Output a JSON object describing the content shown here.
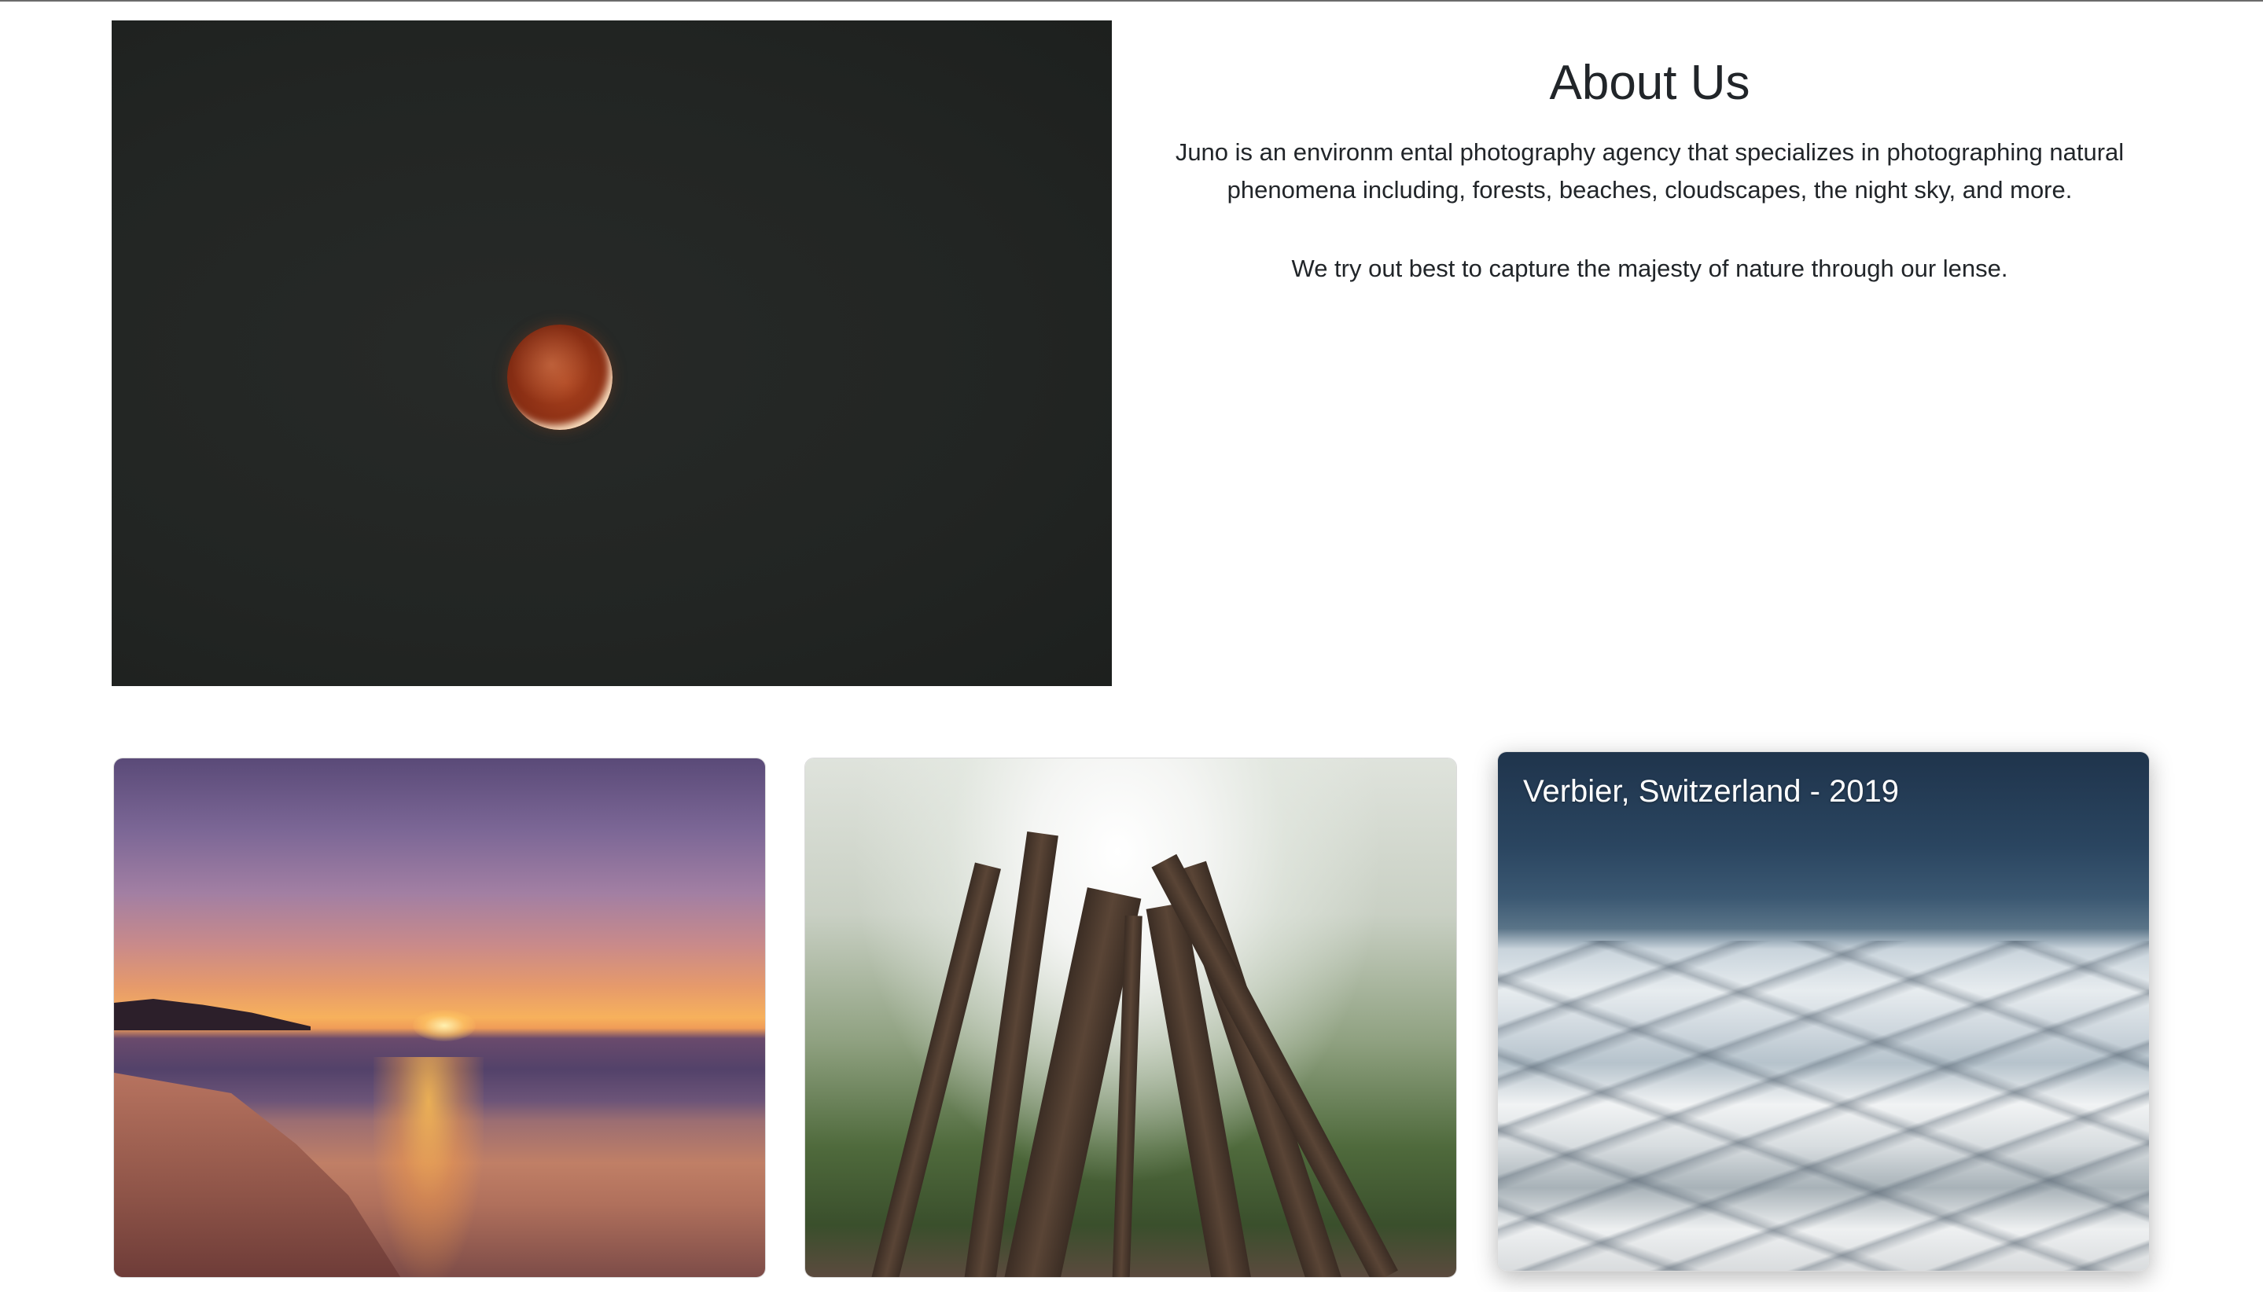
{
  "about": {
    "title": "About Us",
    "paragraph_1": "Juno is an environm ental photography agency that specializes in photographing natural phenomena including, forests, beaches, cloudscapes, the night sky, and more.",
    "paragraph_2": "We try out best to capture the majesty of nature through our lense."
  },
  "gallery": {
    "cards": [
      {
        "caption": ""
      },
      {
        "caption": ""
      },
      {
        "caption": "Verbier, Switzerland - 2019"
      }
    ]
  },
  "colors": {
    "text": "#212529",
    "background": "#ffffff"
  }
}
